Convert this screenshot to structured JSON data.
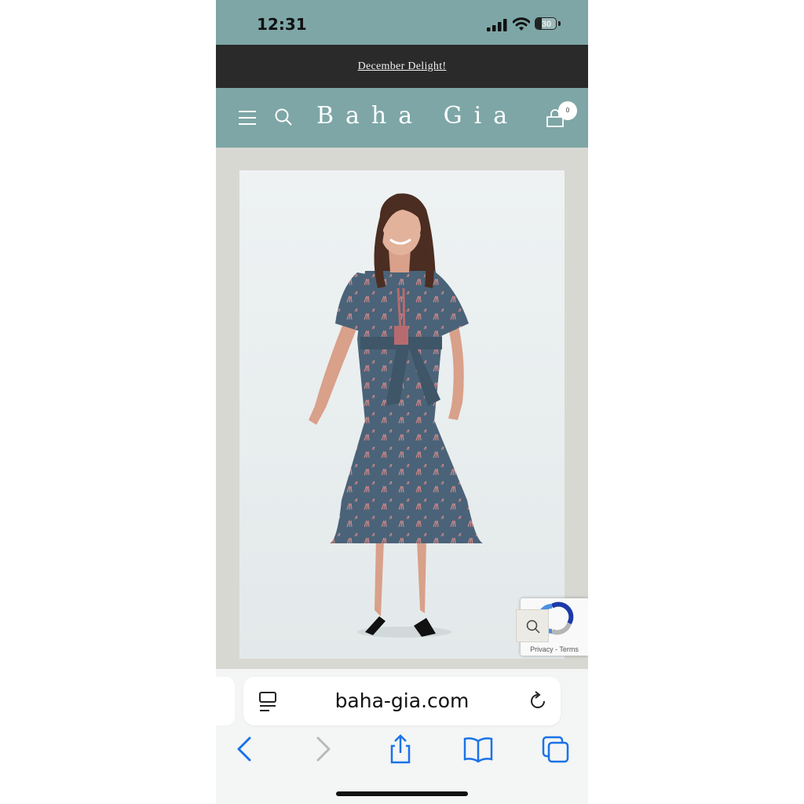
{
  "status_bar": {
    "time": "12:31",
    "battery": "30",
    "battery_level": 0.3
  },
  "announcement": {
    "text": "December Delight!"
  },
  "header": {
    "brand": "Baha Gia",
    "cart_count": "0"
  },
  "recaptcha": {
    "links": "Privacy - Terms"
  },
  "browser": {
    "url": "baha-gia.com"
  },
  "colors": {
    "header_teal": "#7ea6a6",
    "announcement_bg": "#2a2a2a",
    "dress_blue": "#4a6378",
    "page_bg": "#d8d8d2"
  },
  "icons": [
    "menu-icon",
    "search-icon",
    "shopping-bag-icon",
    "reader-icon",
    "reload-icon",
    "back-icon",
    "forward-icon",
    "share-icon",
    "bookmarks-icon",
    "tabs-icon"
  ]
}
